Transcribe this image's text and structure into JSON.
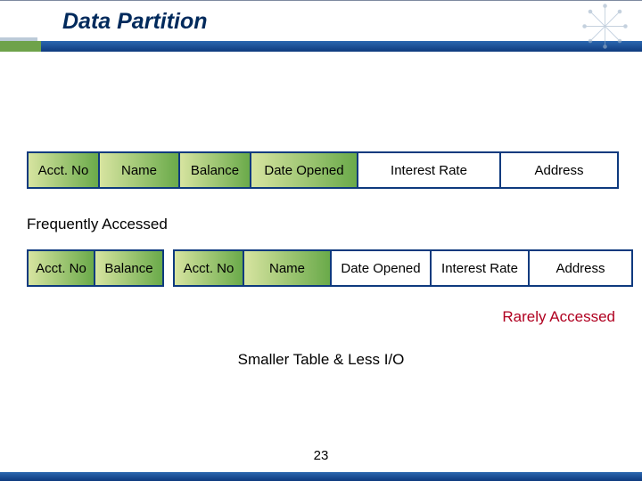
{
  "title": "Data Partition",
  "page_number": "23",
  "main_row": {
    "cells": [
      "Acct. No",
      "Name",
      "Balance",
      "Date Opened",
      "Interest Rate",
      "Address"
    ]
  },
  "freq_label": "Frequently Accessed",
  "split_left": {
    "cells": [
      "Acct. No",
      "Balance"
    ]
  },
  "split_right": {
    "cells": [
      "Acct. No",
      "Name",
      "Date Opened",
      "Interest Rate",
      "Address"
    ]
  },
  "rare_label": "Rarely Accessed",
  "smaller_label": "Smaller Table & Less I/O"
}
